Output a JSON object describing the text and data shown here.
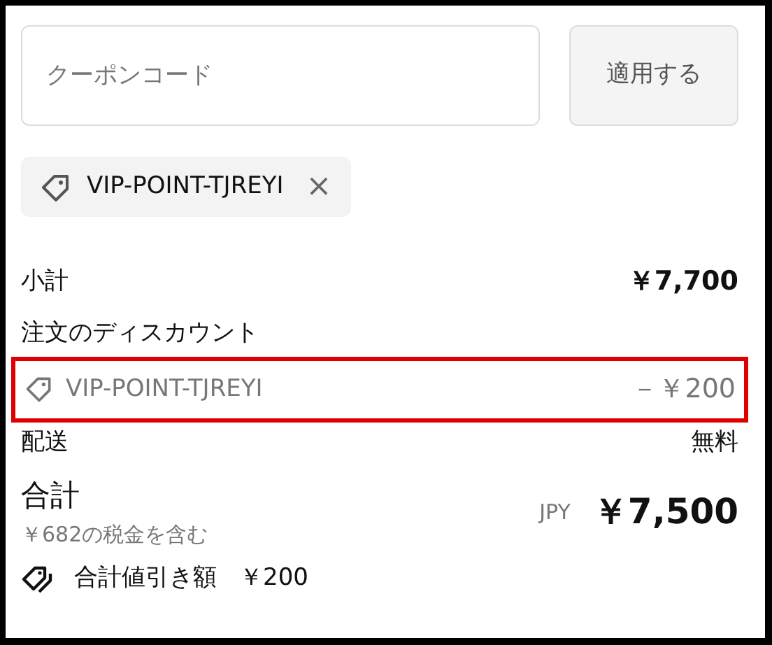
{
  "coupon": {
    "placeholder": "クーポンコード",
    "apply_button": "適用する"
  },
  "applied_codes": [
    {
      "code": "VIP-POINT-TJREYI",
      "remove": "×"
    }
  ],
  "summary": {
    "subtotal": {
      "label": "小計",
      "value": "￥7,700"
    },
    "discount_heading": "注文のディスカウント",
    "discounts": [
      {
        "code": "VIP-POINT-TJREYI",
        "amount": "－￥200",
        "highlighted": true
      }
    ],
    "shipping": {
      "label": "配送",
      "value": "無料"
    },
    "total": {
      "label": "合計",
      "tax_note": "￥682の税金を含む",
      "currency": "JPY",
      "value": "￥7,500"
    },
    "savings": {
      "label": "合計値引き額",
      "value": "￥200"
    }
  }
}
